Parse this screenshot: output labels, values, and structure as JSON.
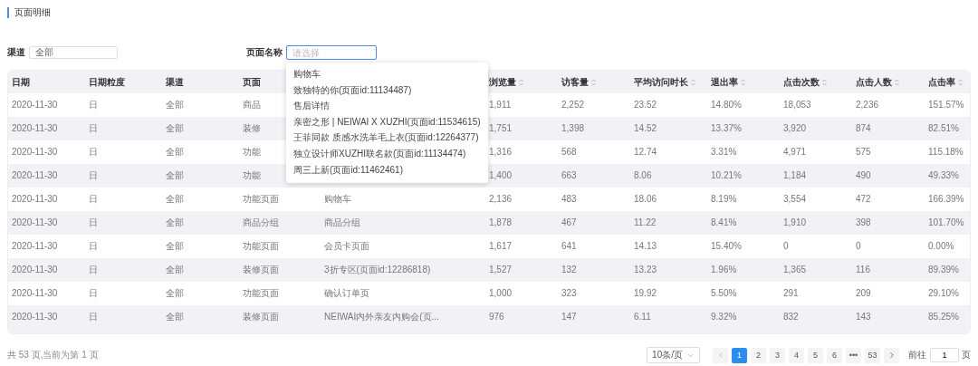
{
  "title": "页面明细",
  "filters": [
    {
      "label": "渠道",
      "kind": "select",
      "value": "全部"
    },
    {
      "label": "页面名称",
      "kind": "input",
      "placeholder": "请选择",
      "focused": true
    }
  ],
  "dropdown": {
    "options": [
      "购物车",
      "致独特的你(页面id:11134487)",
      "售后详情",
      "亲密之形 | NEIWAI X XUZHI(页面id:11534615)",
      "王菲同款 质感水洗羊毛上衣(页面id:12264377)",
      "独立设计师XUZHI联名款(页面id:11134474)",
      "周三上新(页面id:11462461)"
    ]
  },
  "table": {
    "columns": [
      {
        "label": "日期",
        "sortable": false
      },
      {
        "label": "日期粒度",
        "sortable": false
      },
      {
        "label": "渠道",
        "sortable": false
      },
      {
        "label": "页面",
        "sortable": false
      },
      null,
      {
        "label": "浏览量",
        "sortable": true
      },
      {
        "label": "访客量",
        "sortable": true
      },
      {
        "label": "平均访问时长",
        "sortable": true
      },
      {
        "label": "退出率",
        "sortable": true
      },
      {
        "label": "点击次数",
        "sortable": true
      },
      {
        "label": "点击人数",
        "sortable": true
      },
      {
        "label": "点击率",
        "sortable": true
      }
    ],
    "rows": [
      [
        "2020-11-30",
        "日",
        "全部",
        "商品",
        null,
        "1,911",
        "2,252",
        "23.52",
        "14.80%",
        "18,053",
        "2,236",
        "151.57%"
      ],
      [
        "2020-11-30",
        "日",
        "全部",
        "装修",
        null,
        "1,751",
        "1,398",
        "14.52",
        "13.37%",
        "3,920",
        "874",
        "82.51%"
      ],
      [
        "2020-11-30",
        "日",
        "全部",
        "功能",
        null,
        "1,316",
        "568",
        "12.74",
        "3.31%",
        "4,971",
        "575",
        "115.18%"
      ],
      [
        "2020-11-30",
        "日",
        "全部",
        "功能",
        null,
        "1,400",
        "663",
        "8.06",
        "10.21%",
        "1,184",
        "490",
        "49.33%"
      ],
      [
        "2020-11-30",
        "日",
        "全部",
        "功能页面",
        "购物车",
        "2,136",
        "483",
        "18.06",
        "8.19%",
        "3,554",
        "472",
        "166.39%"
      ],
      [
        "2020-11-30",
        "日",
        "全部",
        "商品分组",
        "商品分组",
        "1,878",
        "467",
        "11.22",
        "8.41%",
        "1,910",
        "398",
        "101.70%"
      ],
      [
        "2020-11-30",
        "日",
        "全部",
        "功能页面",
        "会员卡页面",
        "1,617",
        "641",
        "14.13",
        "15.40%",
        "0",
        "0",
        "0.00%"
      ],
      [
        "2020-11-30",
        "日",
        "全部",
        "装修页面",
        "3折专区(页面id:12286818)",
        "1,527",
        "132",
        "13.23",
        "1.96%",
        "1,365",
        "116",
        "89.39%"
      ],
      [
        "2020-11-30",
        "日",
        "全部",
        "功能页面",
        "确认订单页",
        "1,000",
        "323",
        "19.92",
        "5.50%",
        "291",
        "209",
        "29.10%"
      ],
      [
        "2020-11-30",
        "日",
        "全部",
        "装修页面",
        "NEIWAI内外亲友内购会(页...",
        "976",
        "147",
        "6.11",
        "9.32%",
        "832",
        "143",
        "85.25%"
      ]
    ]
  },
  "footer": {
    "summary": "共 53 页,当前为第 1 页",
    "page_size": "10条/页",
    "pages": [
      {
        "label": "1",
        "selected": true
      },
      {
        "label": "2",
        "selected": false
      },
      {
        "label": "3",
        "selected": false
      },
      {
        "label": "4",
        "selected": false
      },
      {
        "label": "5",
        "selected": false
      },
      {
        "label": "6",
        "selected": false
      },
      {
        "label": "•••",
        "selected": false
      },
      {
        "label": "53",
        "selected": false
      }
    ],
    "goto_label": "前往",
    "goto_value": "1",
    "goto_suffix": "页"
  }
}
